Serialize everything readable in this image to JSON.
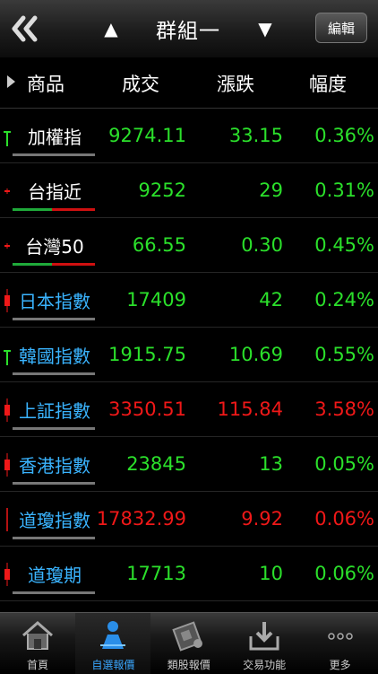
{
  "header": {
    "title": "群組一",
    "edit_label": "編輯"
  },
  "columns": [
    "商品",
    "成交",
    "漲跌",
    "幅度"
  ],
  "rows": [
    {
      "name": "加權指",
      "price": "9274.11",
      "change": "33.15",
      "pct": "0.36%",
      "color": "green",
      "name_color": "white",
      "underline": "gray",
      "indicator": "green-t"
    },
    {
      "name": "台指近",
      "price": "9252",
      "change": "29",
      "pct": "0.31%",
      "color": "green",
      "name_color": "white",
      "underline": "split",
      "indicator": "red-dot"
    },
    {
      "name": "台灣50",
      "price": "66.55",
      "change": "0.30",
      "pct": "0.45%",
      "color": "green",
      "name_color": "white",
      "underline": "split",
      "indicator": "red-dot"
    },
    {
      "name": "日本指數",
      "price": "17409",
      "change": "42",
      "pct": "0.24%",
      "color": "green",
      "name_color": "blue",
      "underline": "gray",
      "indicator": "red-candle"
    },
    {
      "name": "韓國指數",
      "price": "1915.75",
      "change": "10.69",
      "pct": "0.55%",
      "color": "green",
      "name_color": "blue",
      "underline": "gray",
      "indicator": "green-t"
    },
    {
      "name": "上証指數",
      "price": "3350.51",
      "change": "115.84",
      "pct": "3.58%",
      "color": "red",
      "name_color": "blue",
      "underline": "gray",
      "indicator": "red-candle"
    },
    {
      "name": "香港指數",
      "price": "23845",
      "change": "13",
      "pct": "0.05%",
      "color": "green",
      "name_color": "blue",
      "underline": "gray",
      "indicator": "red-candle"
    },
    {
      "name": "道瓊指數",
      "price": "17832.99",
      "change": "9.92",
      "pct": "0.06%",
      "color": "red",
      "name_color": "blue",
      "underline": "gray",
      "indicator": "red-line"
    },
    {
      "name": "道瓊期",
      "price": "17713",
      "change": "10",
      "pct": "0.06%",
      "color": "green",
      "name_color": "blue",
      "underline": "gray",
      "indicator": "red-candle"
    }
  ],
  "tabs": [
    {
      "label": "首頁",
      "icon": "home-icon",
      "active": false
    },
    {
      "label": "自選報價",
      "icon": "favorite-quote-icon",
      "active": true
    },
    {
      "label": "類股報價",
      "icon": "sector-quote-icon",
      "active": false
    },
    {
      "label": "交易功能",
      "icon": "trade-icon",
      "active": false
    },
    {
      "label": "更多",
      "icon": "more-icon",
      "active": false
    }
  ],
  "colors": {
    "up": "#2be02b",
    "down": "#f01818",
    "name_blue": "#3ab4ff",
    "tab_active": "#3aa7ff"
  }
}
